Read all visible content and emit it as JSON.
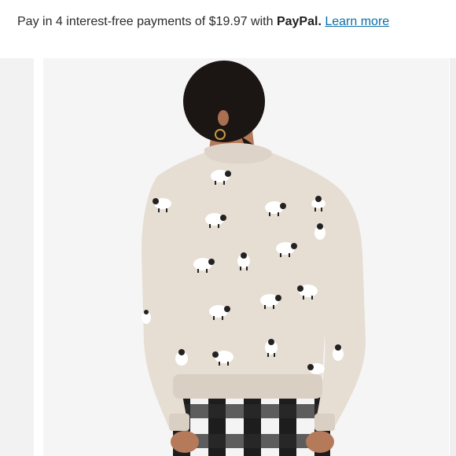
{
  "payment_banner": {
    "prefix": "Pay in 4 interest-free payments of $19.97 with ",
    "brand": "PayPal.",
    "link": "Learn more"
  },
  "product_images": {
    "main_image_icon": "sweater-photo-icon",
    "colors": {
      "background": "#f5f5f5",
      "sweater": "#e6ddd3",
      "link": "#0a6ea8"
    }
  }
}
